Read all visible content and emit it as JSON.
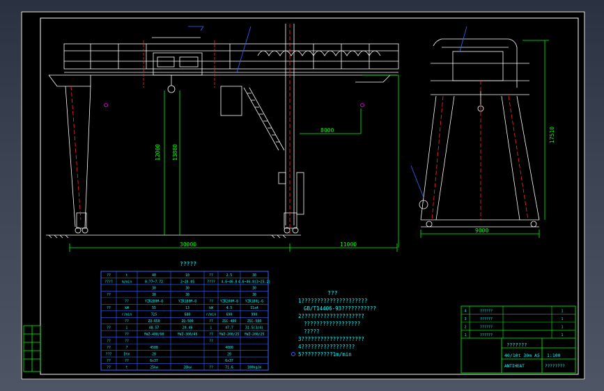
{
  "drawing": {
    "dimensions": {
      "span": "30000",
      "cantilever": "11000",
      "lift_height_a": "12000",
      "lift_height_b": "13880",
      "trolley_offset": "8000",
      "total_height": "17510",
      "base_width": "9000"
    }
  },
  "parameter_table": {
    "title": "?????",
    "rows": [
      [
        "??",
        "t",
        "40",
        "10",
        "??",
        "2.5",
        "30"
      ],
      [
        "????",
        "m/min",
        "0.77~7.72",
        "2~20.05",
        "????",
        "4.6~46.8",
        "4.6~46.8(3~25.2)"
      ],
      [
        "",
        "",
        "30",
        "30",
        "",
        "",
        "30"
      ],
      [
        "??",
        "",
        "30",
        "30",
        "",
        "",
        "30"
      ],
      [
        "",
        "??",
        "YZR280M-8",
        "YZR180M-8",
        "??",
        "YZR200M-8",
        "YZR180L-6"
      ],
      [
        "??",
        "kW",
        "55",
        "13",
        "kW",
        "4.5",
        "11x4"
      ],
      [
        "",
        "r/min",
        "725",
        "680",
        "r/min",
        "690",
        "990"
      ],
      [
        "",
        "??",
        "ZQ-650",
        "ZQ-500",
        "??",
        "ZSC-400",
        "ZSC-500"
      ],
      [
        "??",
        "i",
        "48.57",
        "20.49",
        "i",
        "47.7",
        "31.5(3/4)"
      ],
      [
        "",
        "??",
        "YWZ-400/90",
        "YWZ-300/45",
        "??",
        "YWZ-200/25",
        "YWZ-200/25"
      ],
      [
        "??",
        "??",
        "",
        "",
        "??",
        "",
        ""
      ],
      [
        "??",
        "?",
        "4500",
        "",
        "",
        "4000",
        ""
      ],
      [
        "???",
        "Dtm",
        "20",
        "",
        "",
        "20",
        ""
      ],
      [
        "??",
        "??",
        "6x37",
        "",
        "",
        "6x37",
        ""
      ],
      [
        "??",
        "t",
        "25kw",
        "28kw",
        "??",
        "71.6",
        "100kg/m"
      ]
    ]
  },
  "notes": {
    "title": "???",
    "items": [
      "1?????????????????????",
      "GB/T14406-93???????????",
      "2????????????????????",
      "??????????????????",
      "?????",
      "3????????????????????",
      "4?????????????????",
      "5??????????1m/min"
    ]
  },
  "title_block": {
    "drawing_name": "???????",
    "product": "40/10t  30m  A5",
    "scale": "1:100",
    "code": "ANTIHEAT",
    "company": "????????"
  },
  "parts_list": {
    "rows": [
      [
        "4",
        "??????",
        "1"
      ],
      [
        "3",
        "??????",
        "1"
      ],
      [
        "2",
        "??????",
        "1"
      ],
      [
        "1",
        "??????",
        "1"
      ]
    ]
  },
  "revision_block": {
    "rows": [
      "",
      "",
      ""
    ]
  },
  "colors": {
    "background": "#000000",
    "frame": "#ffffff",
    "structure": "#ffffff",
    "dimension": "#00ff00",
    "centerline": "#ff2a2a",
    "leader": "#3366ff",
    "table_text": "#00ffff",
    "notes_text": "#00ffff",
    "accent": "#ff00ff"
  }
}
